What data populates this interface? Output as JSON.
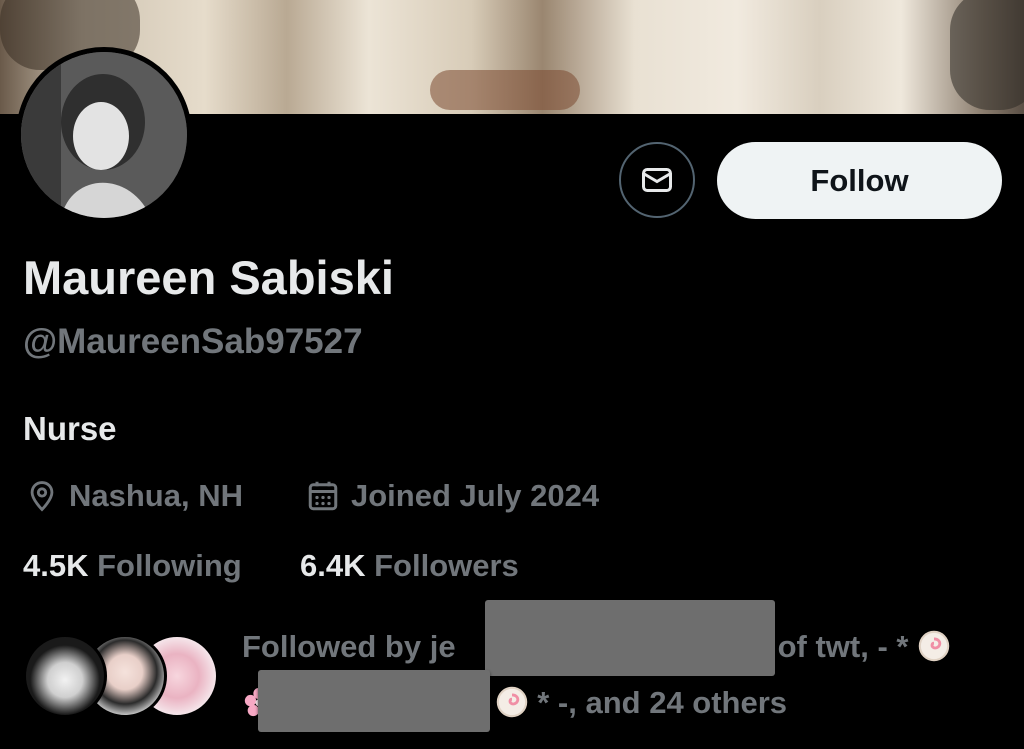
{
  "profile": {
    "name": "Maureen Sabiski",
    "handle": "@MaureenSab97527",
    "bio": "Nurse",
    "location": "Nashua, NH",
    "joined": "Joined July 2024",
    "following_count": "4.5K",
    "following_label": "Following",
    "followers_count": "6.4K",
    "followers_label": "Followers"
  },
  "actions": {
    "follow_label": "Follow",
    "message_icon": "mail-icon"
  },
  "followed_by": {
    "prefix": "Followed by je",
    "middle": "of twt, - *",
    "suffix": "* -, and 24 others"
  },
  "icons": {
    "location": "location-pin-icon",
    "calendar": "calendar-icon",
    "emoji_1": "fishcake-emoji-icon",
    "emoji_2": "cherry-blossom-emoji-icon",
    "emoji_3": "fishcake-emoji-icon"
  },
  "colors": {
    "background": "#000000",
    "primary_text": "#e7e9ea",
    "secondary_text": "#71767b",
    "follow_button_bg": "#eff3f4",
    "follow_button_text": "#0f1419",
    "border": "#536471"
  }
}
